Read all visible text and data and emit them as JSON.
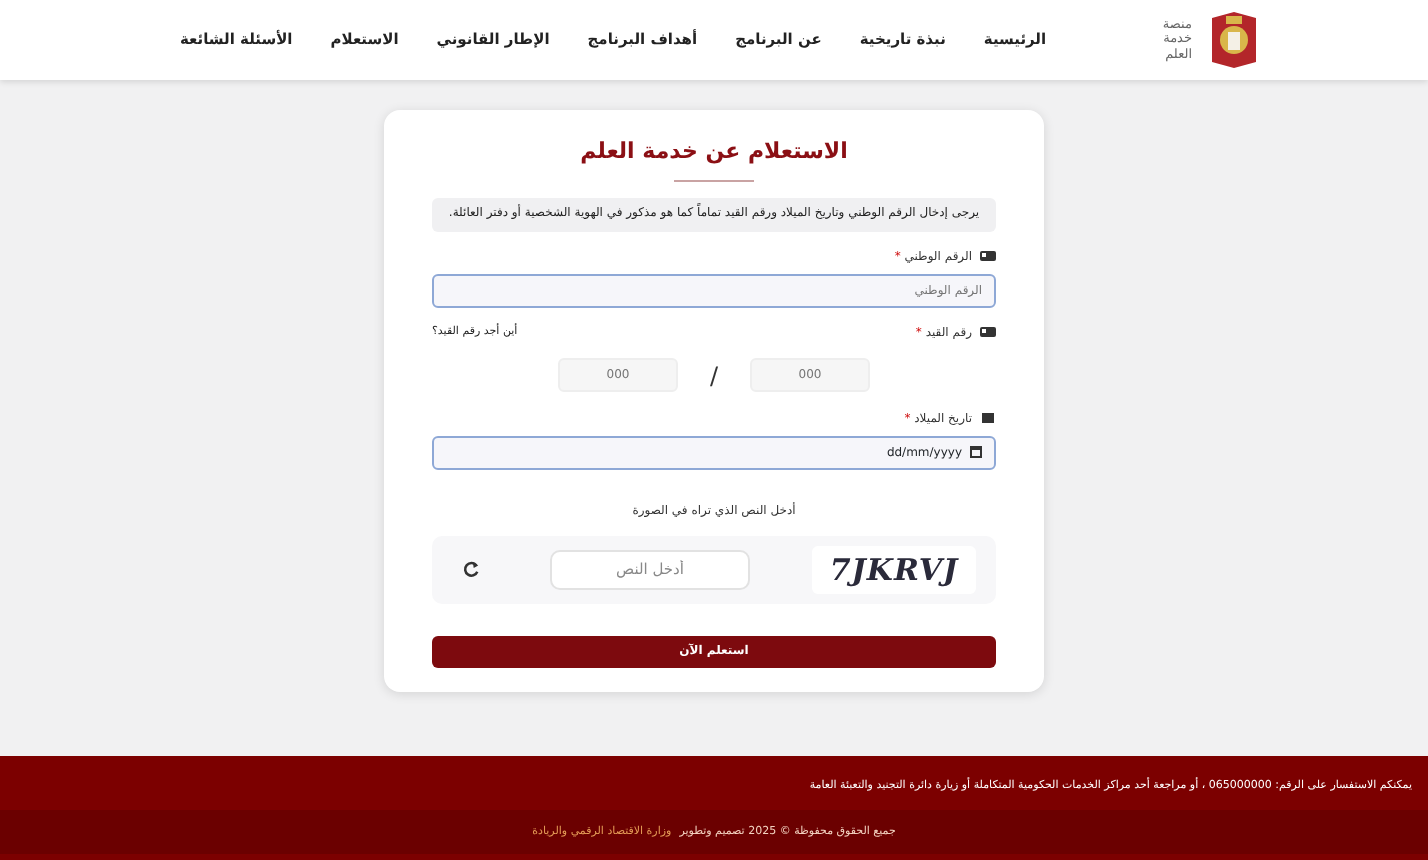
{
  "header": {
    "logo_lines": [
      "منصة",
      "خدمة",
      "العلم"
    ],
    "nav": [
      {
        "label": "الرئيسية"
      },
      {
        "label": "نبذة تاريخية"
      },
      {
        "label": "عن البرنامج"
      },
      {
        "label": "أهداف البرنامج"
      },
      {
        "label": "الإطار القانوني"
      },
      {
        "label": "الاستعلام"
      },
      {
        "label": "الأسئلة الشائعة"
      }
    ]
  },
  "form": {
    "title": "الاستعلام عن خدمة العلم",
    "note": "يرجى إدخال الرقم الوطني وتاريخ الميلاد ورقم القيد تماماً كما هو مذكور في الهوية الشخصية أو دفتر العائلة.",
    "fields": [
      {
        "kind": "text",
        "label": "الرقم الوطني",
        "marker": "*",
        "placeholder": "الرقم الوطني"
      },
      {
        "kind": "pair",
        "label": "رقم القيد",
        "marker": "*",
        "help_link": "أين أجد رقم القيد؟",
        "placeholders": [
          "000",
          "000"
        ],
        "separator": "/"
      },
      {
        "kind": "date",
        "label": "تاريخ الميلاد",
        "marker": "*",
        "value": "dd/mm/yyyy"
      }
    ],
    "captcha": {
      "prompt": "أدخل النص الذي تراه في الصورة",
      "code": "7JKRVJ",
      "placeholder": "أدخل النص"
    },
    "submit": "استعلم الآن"
  },
  "footer": {
    "contact": "يمكنكم الاستفسار على الرقم: 065000000 ، أو مراجعة أحد مراكز الخدمات الحكومية المتكاملة أو زيارة دائرة التجنيد والتعبئة العامة",
    "copyright": "جميع الحقوق محفوظة © 2025 تصميم وتطوير",
    "credit_link": "وزارة الاقتصاد الرقمي والريادة"
  }
}
